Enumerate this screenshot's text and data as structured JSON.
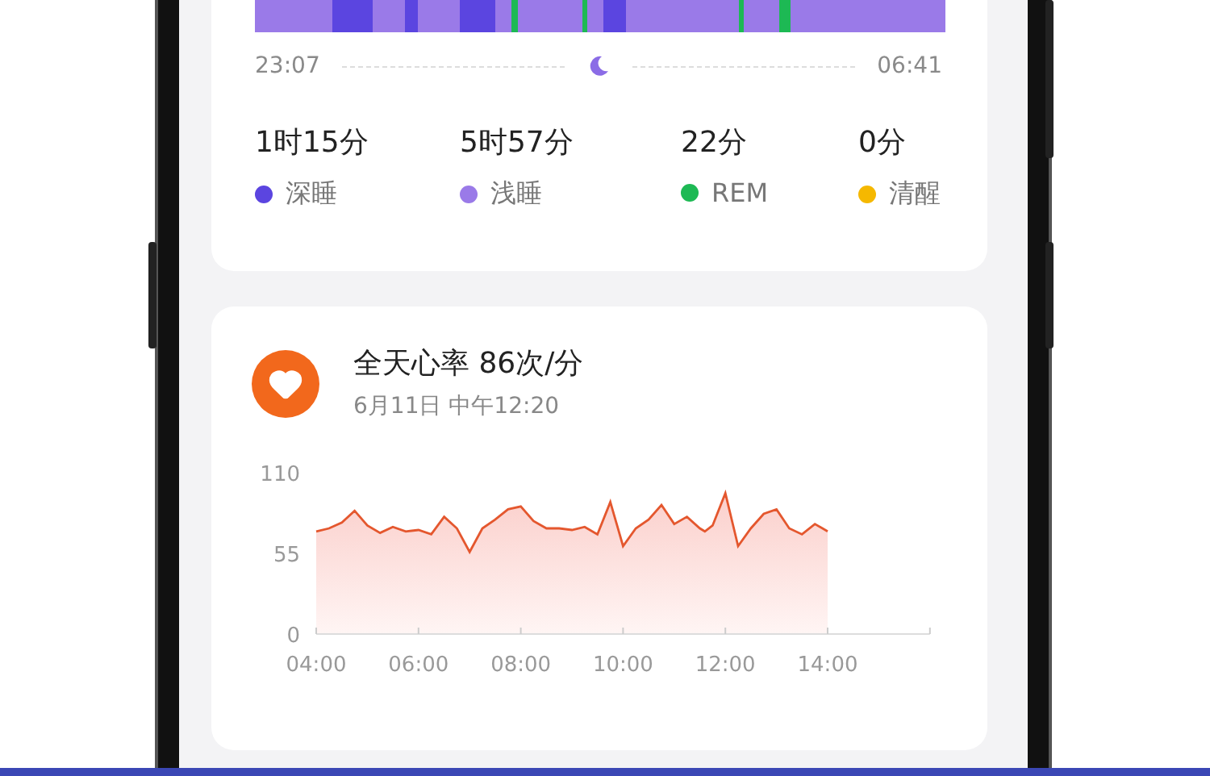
{
  "sleep": {
    "start_time": "23:07",
    "end_time": "06:41",
    "stages": [
      {
        "value": "1时15分",
        "label": "深睡",
        "color": "#5b45e0"
      },
      {
        "value": "5时57分",
        "label": "浅睡",
        "color": "#9a7ae8"
      },
      {
        "value": "22分",
        "label": "REM",
        "color": "#1db954"
      },
      {
        "value": "0分",
        "label": "清醒",
        "color": "#f5b800"
      }
    ]
  },
  "heart_rate": {
    "title": "全天心率 86次/分",
    "subtitle": "6月11日 中午12:20",
    "chart_data": {
      "type": "area",
      "x": [
        4,
        4.25,
        4.5,
        4.75,
        5,
        5.25,
        5.5,
        5.75,
        6,
        6.25,
        6.5,
        6.75,
        7,
        7.25,
        7.5,
        7.75,
        8,
        8.25,
        8.5,
        8.75,
        9,
        9.25,
        9.5,
        9.75,
        10,
        10.25,
        10.5,
        10.75,
        11,
        11.25,
        11.5,
        11.6,
        11.75,
        12,
        12.25,
        12.5,
        12.75,
        13,
        13.25,
        13.5,
        13.75,
        14
      ],
      "series": [
        {
          "color": "#e4572e",
          "values": [
            70,
            72,
            76,
            84,
            74,
            69,
            73,
            70,
            71,
            68,
            80,
            72,
            56,
            72,
            78,
            85,
            87,
            77,
            72,
            72,
            71,
            73,
            68,
            90,
            60,
            72,
            78,
            88,
            75,
            80,
            72,
            70,
            74,
            96,
            60,
            72,
            82,
            85,
            72,
            68,
            75,
            70
          ]
        }
      ],
      "xlim": [
        4,
        16
      ],
      "ylim": [
        0,
        110
      ],
      "yticks": [
        0,
        55,
        110
      ],
      "xticks": [
        {
          "value": 4,
          "label": "04:00"
        },
        {
          "value": 6,
          "label": "06:00"
        },
        {
          "value": 8,
          "label": "08:00"
        },
        {
          "value": 10,
          "label": "10:00"
        },
        {
          "value": 12,
          "label": "12:00"
        },
        {
          "value": 14,
          "label": "14:00"
        }
      ]
    }
  }
}
